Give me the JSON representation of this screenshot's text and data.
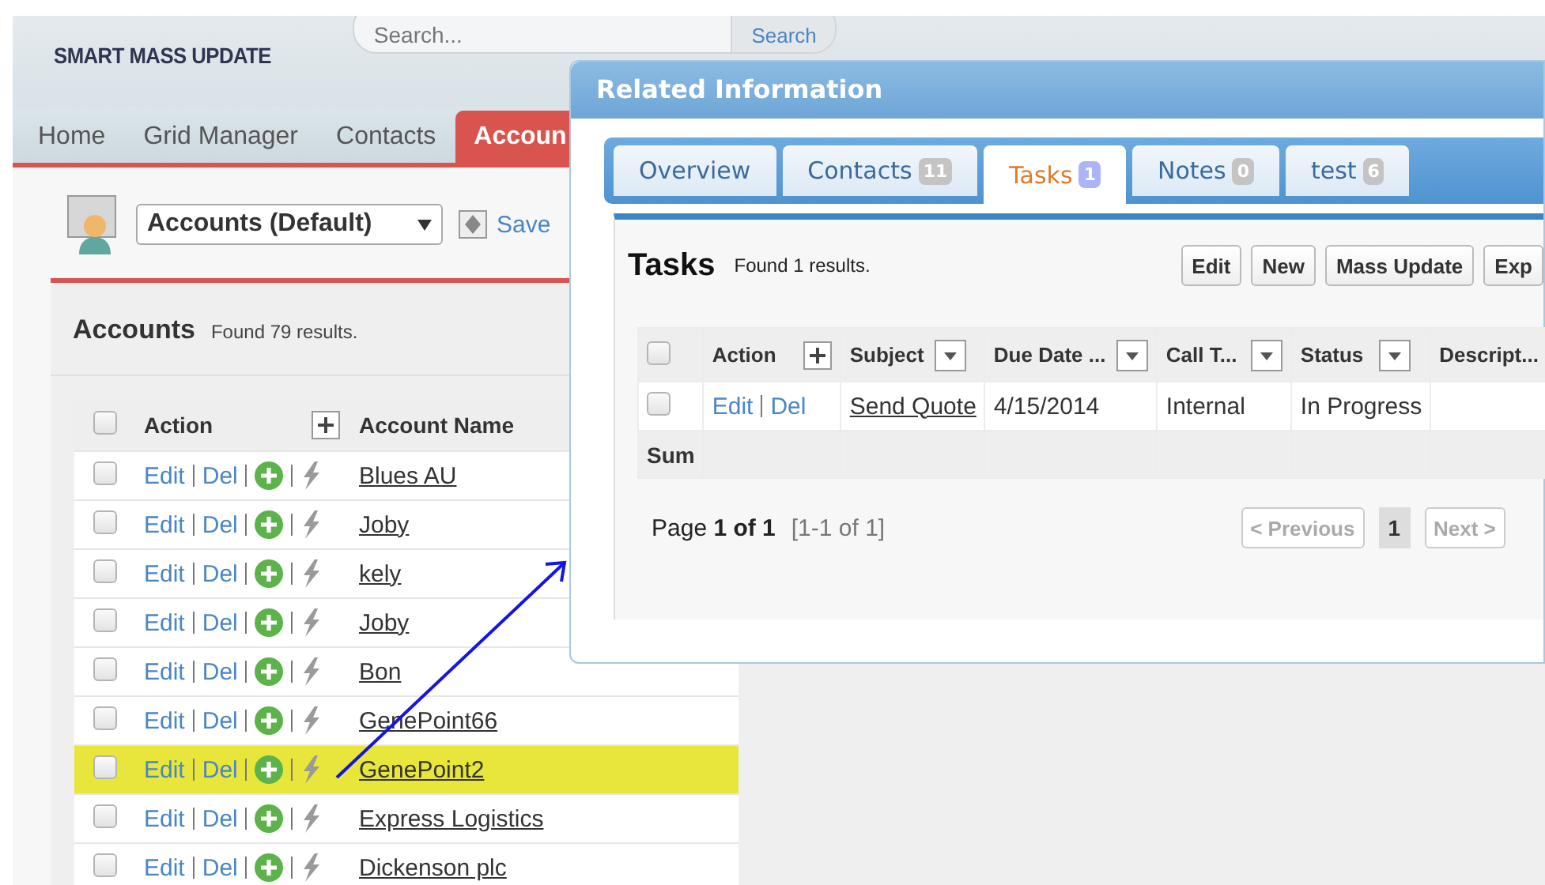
{
  "header": {
    "subtitle": "SMART MASS UPDATE",
    "search": {
      "placeholder": "Search..."
    },
    "search_button": "Search"
  },
  "nav_tabs": [
    {
      "label": "Home",
      "selected": false
    },
    {
      "label": "Grid Manager",
      "selected": false
    },
    {
      "label": "Contacts",
      "selected": false
    },
    {
      "label": "Accoun",
      "selected": true
    }
  ],
  "list_view": {
    "value": "Accounts (Default)",
    "save_label": "Save"
  },
  "accounts": {
    "title": "Accounts",
    "count": "Found 79 results.",
    "header_checked": false,
    "columns": [
      "Action",
      "Account Name"
    ],
    "rows": [
      {
        "checked": false,
        "edit": "Edit",
        "del": "Del",
        "name": "Blues AU",
        "selected": false
      },
      {
        "checked": false,
        "edit": "Edit",
        "del": "Del",
        "name": "Joby",
        "selected": false
      },
      {
        "checked": false,
        "edit": "Edit",
        "del": "Del",
        "name": "kely",
        "selected": false
      },
      {
        "checked": false,
        "edit": "Edit",
        "del": "Del",
        "name": "Joby",
        "selected": false
      },
      {
        "checked": false,
        "edit": "Edit",
        "del": "Del",
        "name": "Bon",
        "selected": false
      },
      {
        "checked": false,
        "edit": "Edit",
        "del": "Del",
        "name": "GenePoint66",
        "selected": false
      },
      {
        "checked": false,
        "edit": "Edit",
        "del": "Del",
        "name": "GenePoint2",
        "selected": true
      },
      {
        "checked": false,
        "edit": "Edit",
        "del": "Del",
        "name": "Express Logistics",
        "selected": false
      },
      {
        "checked": false,
        "edit": "Edit",
        "del": "Del",
        "name": "Dickenson plc",
        "selected": false
      }
    ]
  },
  "dialog": {
    "title": "Related Information",
    "tabs": [
      {
        "label": "Overview",
        "selected": false
      },
      {
        "label": "Contacts",
        "badge": "11",
        "selected": false
      },
      {
        "label": "Tasks",
        "badge": "1",
        "selected": true
      },
      {
        "label": "Notes",
        "badge": "0",
        "selected": false
      },
      {
        "label": "test",
        "badge": "6",
        "selected": false
      }
    ],
    "tasks": {
      "title": "Tasks",
      "count": "Found 1 results.",
      "buttons": [
        "Edit",
        "New",
        "Mass Update",
        "Exp"
      ],
      "header_checked": false,
      "columns": [
        {
          "label": "Action",
          "kind": "add"
        },
        {
          "label": "Subject",
          "kind": "menu"
        },
        {
          "label": "Due Date ...",
          "kind": "menu"
        },
        {
          "label": "Call T...",
          "kind": "menu"
        },
        {
          "label": "Status",
          "kind": "menu"
        },
        {
          "label": "Descript...",
          "kind": "plain"
        }
      ],
      "rows": [
        {
          "checked": false,
          "edit": "Edit",
          "del": "Del",
          "subject": "Send Quote",
          "due": "4/15/2014",
          "call_type": "Internal",
          "status": "In Progress"
        }
      ],
      "sum_label": "Sum",
      "pager": {
        "info": "Page **1 of 1**",
        "range": "[1-1 of 1]",
        "previous": "< Previous",
        "current": "1",
        "next": "Next >"
      }
    }
  }
}
